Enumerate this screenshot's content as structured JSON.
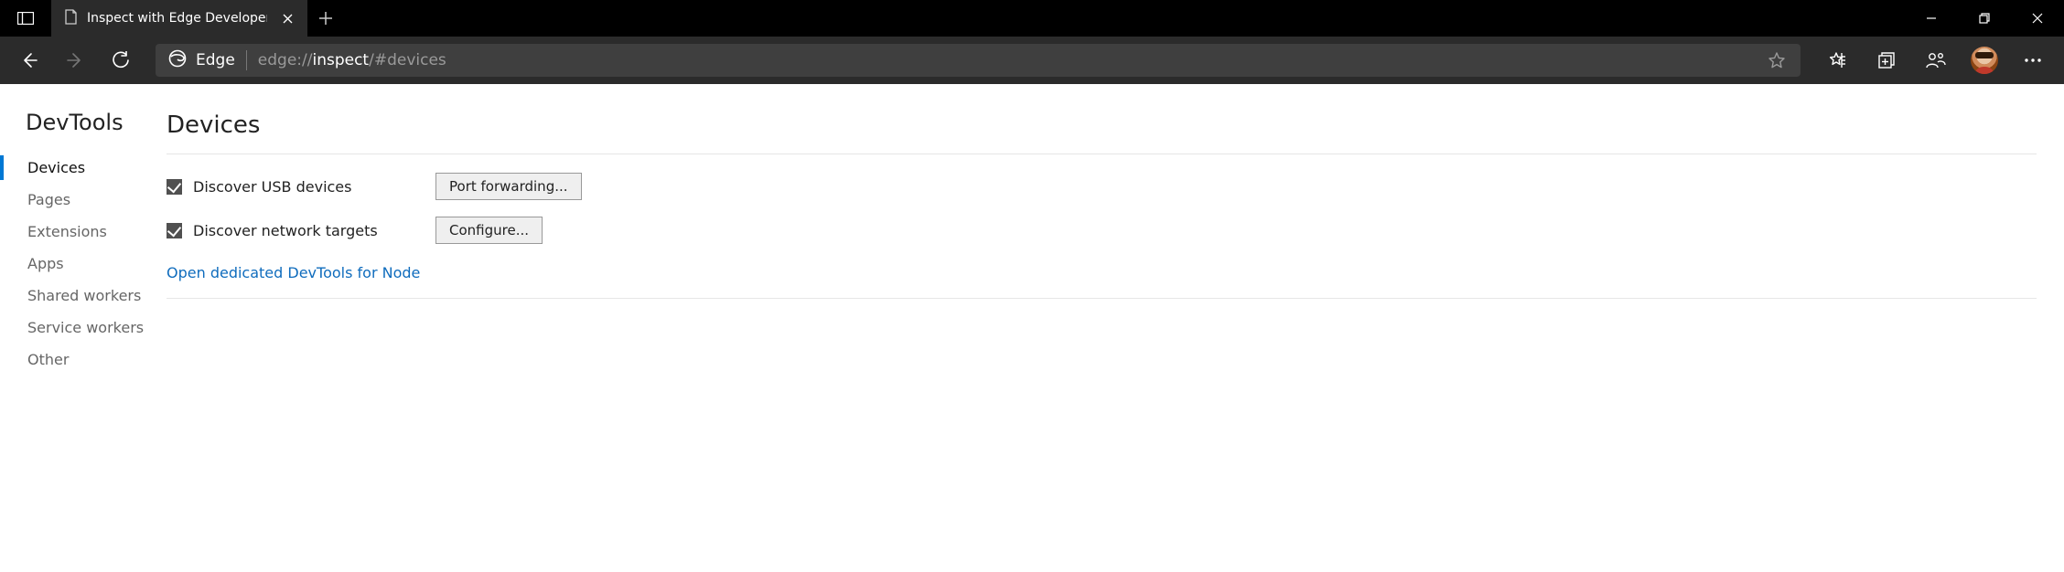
{
  "window": {
    "tab_title": "Inspect with Edge Developer Too"
  },
  "addressbar": {
    "brand": "Edge",
    "url_scheme": "edge://",
    "url_path": "inspect",
    "url_frag": "/#devices"
  },
  "sidebar": {
    "title": "DevTools",
    "items": [
      {
        "label": "Devices",
        "active": true
      },
      {
        "label": "Pages"
      },
      {
        "label": "Extensions"
      },
      {
        "label": "Apps"
      },
      {
        "label": "Shared workers"
      },
      {
        "label": "Service workers"
      },
      {
        "label": "Other"
      }
    ]
  },
  "main": {
    "title": "Devices",
    "check_usb_label": "Discover USB devices",
    "check_net_label": "Discover network targets",
    "btn_port_forwarding": "Port forwarding...",
    "btn_configure": "Configure...",
    "node_link": "Open dedicated DevTools for Node"
  }
}
